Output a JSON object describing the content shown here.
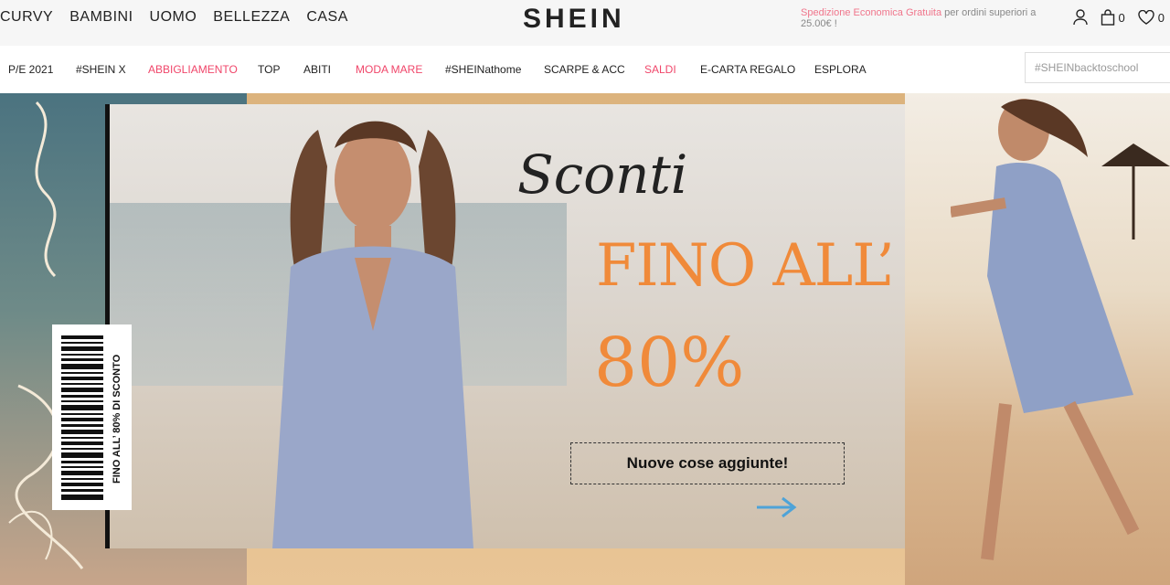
{
  "top_categories": [
    "CURVY",
    "BAMBINI",
    "UOMO",
    "BELLEZZA",
    "CASA"
  ],
  "logo": "SHEIN",
  "promo": {
    "highlight": "Spedizione Economica Gratuita",
    "rest": " per ordini superiori a 25.00€ !"
  },
  "header_icons": {
    "bag_count": "0",
    "wishlist_count": "0"
  },
  "nav": [
    {
      "label": "P/E 2021",
      "highlight": false
    },
    {
      "label": "#SHEIN X",
      "highlight": false
    },
    {
      "label": "ABBIGLIAMENTO",
      "highlight": true
    },
    {
      "label": "TOP",
      "highlight": false
    },
    {
      "label": "ABITI",
      "highlight": false
    },
    {
      "label": "MODA MARE",
      "highlight": true
    },
    {
      "label": "#SHEINathome",
      "highlight": false
    },
    {
      "label": "SCARPE & ACC",
      "highlight": false
    },
    {
      "label": "SALDI",
      "highlight": true
    },
    {
      "label": "E-CARTA REGALO",
      "highlight": false
    },
    {
      "label": "ESPLORA",
      "highlight": false
    }
  ],
  "search": {
    "placeholder": "#SHEINbacktoschool"
  },
  "banner": {
    "script": "Sconti",
    "headline": "FINO ALL’",
    "percent": "80%",
    "cta": "Nuove cose aggiunte!",
    "ticket_text": "FINO ALL’ 80% DI SCONTO"
  },
  "colors": {
    "accent": "#f08a3a",
    "nav_highlight": "#f0466a",
    "promo": "#f0758b",
    "arrow": "#4ea3d8"
  },
  "icons": [
    "user-icon",
    "bag-icon",
    "heart-icon",
    "arrow-right-icon"
  ]
}
